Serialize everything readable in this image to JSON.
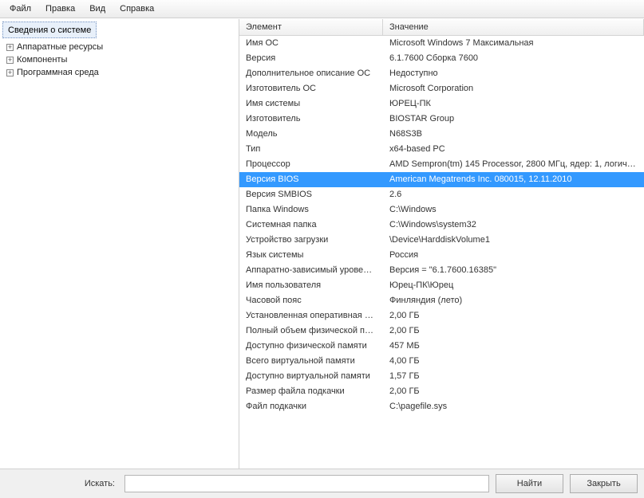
{
  "menu": {
    "file": "Файл",
    "edit": "Правка",
    "view": "Вид",
    "help": "Справка"
  },
  "tree": {
    "root": "Сведения о системе",
    "items": [
      {
        "label": "Аппаратные ресурсы"
      },
      {
        "label": "Компоненты"
      },
      {
        "label": "Программная среда"
      }
    ]
  },
  "columns": {
    "element": "Элемент",
    "value": "Значение"
  },
  "rows": [
    {
      "element": "Имя ОС",
      "value": "Microsoft Windows 7 Максимальная",
      "selected": false
    },
    {
      "element": "Версия",
      "value": "6.1.7600 Сборка 7600",
      "selected": false
    },
    {
      "element": "Дополнительное описание ОС",
      "value": "Недоступно",
      "selected": false
    },
    {
      "element": "Изготовитель ОС",
      "value": "Microsoft Corporation",
      "selected": false
    },
    {
      "element": "Имя системы",
      "value": "ЮРЕЦ-ПК",
      "selected": false
    },
    {
      "element": "Изготовитель",
      "value": "BIOSTAR Group",
      "selected": false
    },
    {
      "element": "Модель",
      "value": "N68S3B",
      "selected": false
    },
    {
      "element": "Тип",
      "value": "x64-based PC",
      "selected": false
    },
    {
      "element": "Процессор",
      "value": "AMD Sempron(tm) 145 Processor, 2800 МГц, ядер: 1, логич…",
      "selected": false
    },
    {
      "element": "Версия BIOS",
      "value": "American Megatrends Inc. 080015, 12.11.2010",
      "selected": true
    },
    {
      "element": "Версия SMBIOS",
      "value": "2.6",
      "selected": false
    },
    {
      "element": "Папка Windows",
      "value": "C:\\Windows",
      "selected": false
    },
    {
      "element": "Системная папка",
      "value": "C:\\Windows\\system32",
      "selected": false
    },
    {
      "element": "Устройство загрузки",
      "value": "\\Device\\HarddiskVolume1",
      "selected": false
    },
    {
      "element": "Язык системы",
      "value": "Россия",
      "selected": false
    },
    {
      "element": "Аппаратно-зависимый уровен…",
      "value": "Версия = \"6.1.7600.16385\"",
      "selected": false
    },
    {
      "element": "Имя пользователя",
      "value": "Юрец-ПК\\Юрец",
      "selected": false
    },
    {
      "element": "Часовой пояс",
      "value": "Финляндия (лето)",
      "selected": false
    },
    {
      "element": "Установленная оперативная п…",
      "value": "2,00 ГБ",
      "selected": false
    },
    {
      "element": "Полный объем физической па…",
      "value": "2,00 ГБ",
      "selected": false
    },
    {
      "element": "Доступно физической памяти",
      "value": "457 МБ",
      "selected": false
    },
    {
      "element": "Всего виртуальной памяти",
      "value": "4,00 ГБ",
      "selected": false
    },
    {
      "element": "Доступно виртуальной памяти",
      "value": "1,57 ГБ",
      "selected": false
    },
    {
      "element": "Размер файла подкачки",
      "value": "2,00 ГБ",
      "selected": false
    },
    {
      "element": "Файл подкачки",
      "value": "C:\\pagefile.sys",
      "selected": false
    }
  ],
  "footer": {
    "search_label": "Искать:",
    "find_button": "Найти",
    "close_button": "Закрыть",
    "search_value": ""
  }
}
